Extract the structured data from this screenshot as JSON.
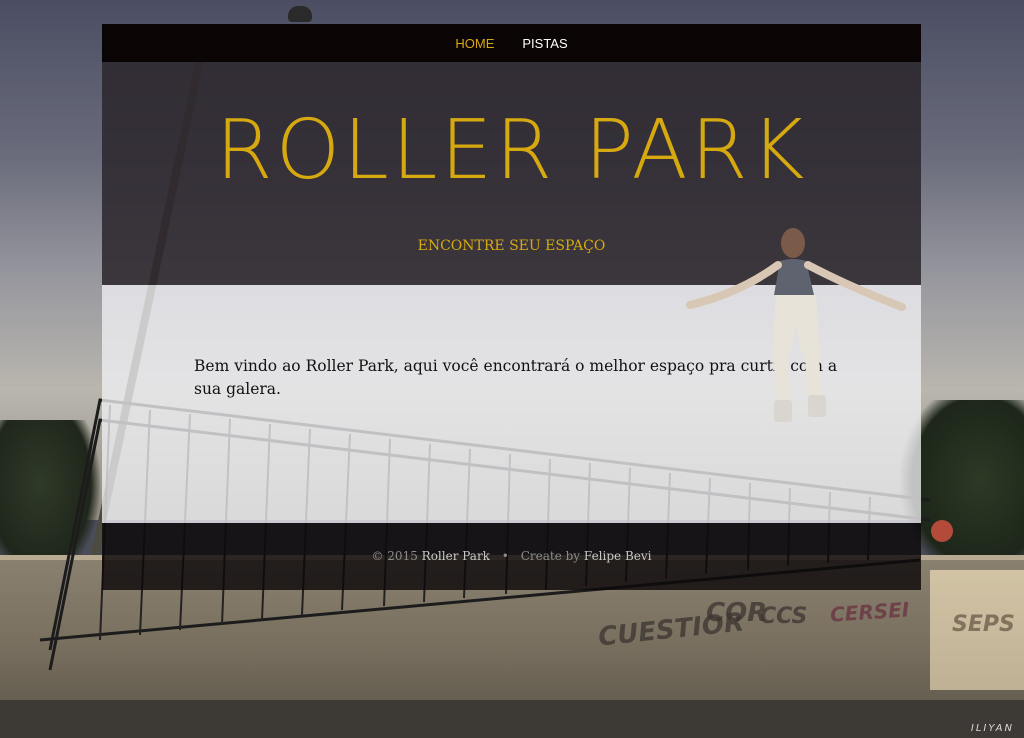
{
  "nav": {
    "items": [
      {
        "label": "HOME",
        "active": true
      },
      {
        "label": "PISTAS",
        "active": false
      }
    ]
  },
  "hero": {
    "title": "ROLLER PARK",
    "subtitle": "ENCONTRE SEU ESPAÇO"
  },
  "content": {
    "welcome_text": "Bem vindo ao Roller Park, aqui você encontrará o melhor espaço pra curtir com a sua galera."
  },
  "footer": {
    "copyright": "© 2015",
    "site_name": "Roller Park",
    "separator": "•",
    "credit_prefix": "Create by",
    "author": "Felipe Bevi"
  },
  "background": {
    "watermark": "ILIYAN",
    "graffiti": [
      "CUESTIOR",
      "COR",
      "CCS",
      "SEPS",
      "CERSEI"
    ]
  },
  "colors": {
    "accent": "#d7a910",
    "navbar_bg": "#0b0404",
    "hero_bg": "rgba(44,38,44,0.86)",
    "content_bg": "rgba(240,240,244,0.78)",
    "footer_bg": "rgba(12,8,10,0.82)"
  }
}
